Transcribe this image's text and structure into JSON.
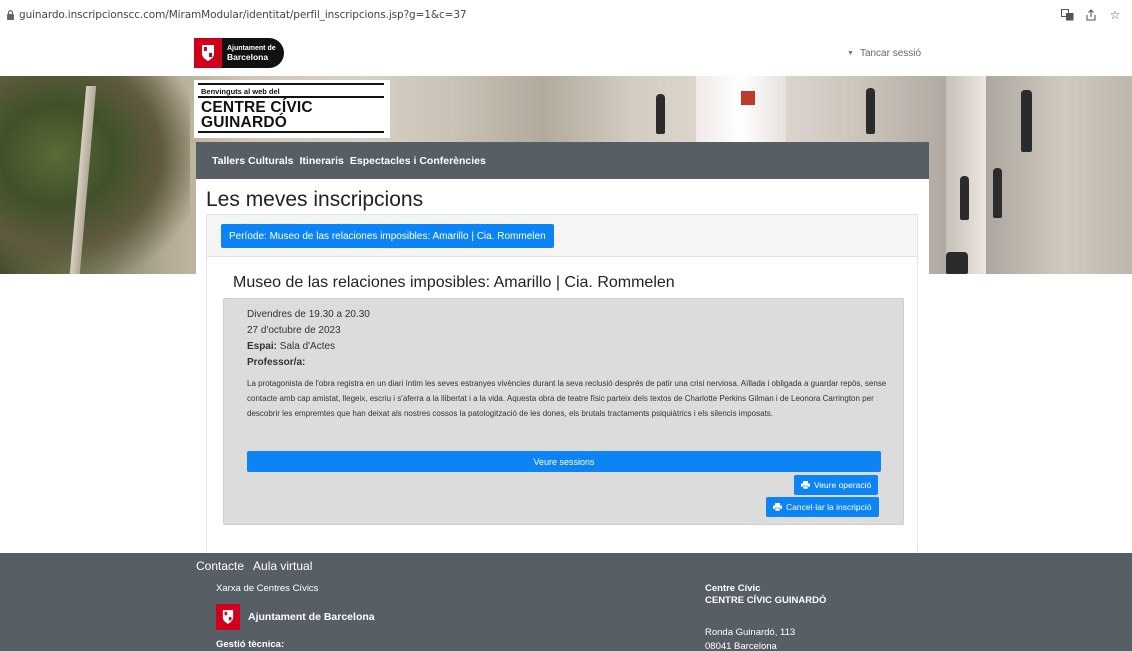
{
  "browser": {
    "url": "guinardo.inscripcionscc.com/MiramModular/identitat/perfil_inscripcions.jsp?g=1&c=37"
  },
  "header": {
    "logo_line1": "Ajuntament de",
    "logo_line2": "Barcelona",
    "logout_label": "Tancar sessió"
  },
  "brand": {
    "subtitle": "Benvinguts al web del",
    "name_line1": "CENTRE CÍVIC",
    "name_line2": "GUINARDÓ"
  },
  "nav": {
    "items": [
      {
        "label": "Tallers Culturals"
      },
      {
        "label": "Itineraris"
      },
      {
        "label": "Espectacles i Conferències"
      }
    ]
  },
  "main": {
    "title": "Les meves inscripcions",
    "period_label": "Període: Museo de las relaciones imposibles: Amarillo | Cia. Rommelen",
    "course": {
      "title": "Museo de las relaciones imposibles: Amarillo | Cia. Rommelen",
      "schedule": "Divendres de 19.30 a 20.30",
      "date": "27 d'octubre de 2023",
      "space_label": "Espai:",
      "space_value": "Sala d'Actes",
      "teacher_label": "Professor/a:",
      "description": "La protagonista de l'obra registra en un diari íntim les seves estranyes vivències durant la seva reclusió després de patir una crisi nerviosa. Aïllada i obligada a guardar repòs, sense contacte amb cap amistat, llegeix, escriu i s'aferra a la llibertat i a la vida. Aquesta obra de teatre físic parteix dels textos de Charlotte Perkins Gilman i de Leonora Carrington per descobrir les empremtes que han deixat als nostres cossos la patologització de les dones, els brutals tractaments psiquiàtrics i els silencis imposats.",
      "sessions_button": "Veure sessions",
      "operation_button": "Veure operació",
      "cancel_button": "Cancel·lar la inscripció"
    }
  },
  "footer": {
    "links": [
      {
        "label": "Contacte"
      },
      {
        "label": "Aula virtual"
      }
    ],
    "network": "Xarxa de Centres Cívics",
    "ajuntament": "Ajuntament de Barcelona",
    "gestio": "Gestió tècnica:",
    "centre_label": "Centre Cívic",
    "centre_name": "CENTRE CÍVIC GUINARDÓ",
    "address_line1": "Ronda Guinardó, 113",
    "address_line2": "08041 Barcelona"
  },
  "colors": {
    "primary": "#0d84f5",
    "nav_bg": "#585e66",
    "detail_bg": "#dcdcdc",
    "brand_red": "#d0021b"
  },
  "icons": {
    "lock": "lock-icon",
    "translate": "translate-icon",
    "share": "share-icon",
    "star": "star-icon",
    "caret": "caret-down-icon",
    "printer": "printer-icon",
    "shield": "barcelona-shield-icon"
  }
}
